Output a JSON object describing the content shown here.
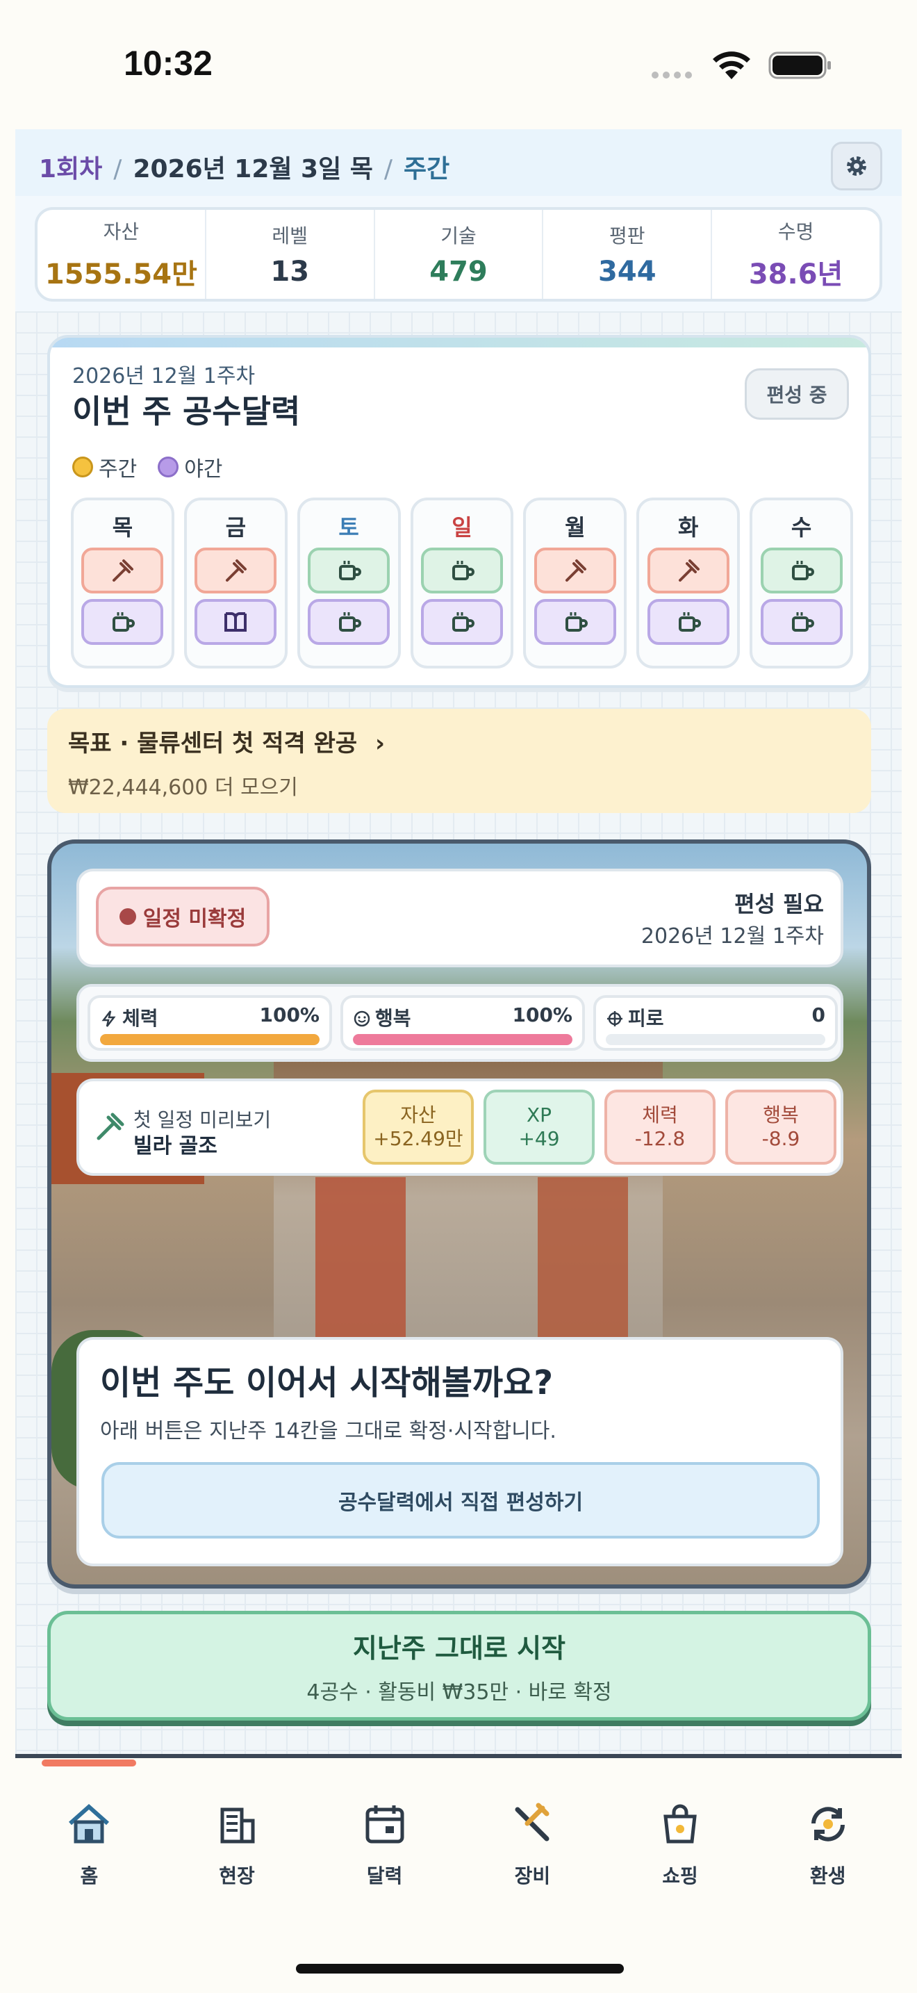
{
  "status_bar": {
    "time": "10:32"
  },
  "header": {
    "round": "1회차",
    "date": "2026년 12월 3일 목",
    "period": "주간"
  },
  "stats": [
    {
      "label": "자산",
      "value": "1555.54만",
      "color": "#a77412"
    },
    {
      "label": "레벨",
      "value": "13",
      "color": "#2c3a4a"
    },
    {
      "label": "기술",
      "value": "479",
      "color": "#2e7d5b"
    },
    {
      "label": "평판",
      "value": "344",
      "color": "#2f6aa0"
    },
    {
      "label": "수명",
      "value": "38.6년",
      "color": "#7a4cb5"
    }
  ],
  "calendar": {
    "week": "2026년 12월 1주차",
    "title": "이번 주 공수달력",
    "edit_button": "편성 중",
    "legend": {
      "day": "주간",
      "night": "야간"
    },
    "days": [
      {
        "label": "목",
        "color": "#2a3644",
        "day_slot": "work",
        "night_slot": "rest"
      },
      {
        "label": "금",
        "color": "#2a3644",
        "day_slot": "work",
        "night_slot": "study"
      },
      {
        "label": "토",
        "color": "#3b7db5",
        "day_slot": "rest",
        "night_slot": "rest"
      },
      {
        "label": "일",
        "color": "#c94343",
        "day_slot": "rest",
        "night_slot": "rest"
      },
      {
        "label": "월",
        "color": "#2a3644",
        "day_slot": "work",
        "night_slot": "rest"
      },
      {
        "label": "화",
        "color": "#2a3644",
        "day_slot": "work",
        "night_slot": "rest"
      },
      {
        "label": "수",
        "color": "#2a3644",
        "day_slot": "rest",
        "night_slot": "rest"
      }
    ]
  },
  "goal": {
    "title": "목표 · 물류센터 첫 적격 완공",
    "chevron": "›",
    "subtitle": "₩22,444,600 더 모으기"
  },
  "scene": {
    "status_pill": "일정 미확정",
    "edit_needed": "편성 필요",
    "week": "2026년 12월 1주차",
    "gauges": [
      {
        "label": "체력",
        "value": "100%",
        "fill": 1.0,
        "color": "#f2a83e",
        "icon": "bolt-icon"
      },
      {
        "label": "행복",
        "value": "100%",
        "fill": 1.0,
        "color": "#ee7a9b",
        "icon": "smile-icon"
      },
      {
        "label": "피로",
        "value": "0",
        "fill": 0.0,
        "color": "#9aa8b5",
        "icon": "fatigue-icon"
      }
    ],
    "preview": {
      "label": "첫 일정 미리보기",
      "job": "빌라 골조"
    },
    "chips": [
      {
        "label": "자산",
        "value": "+52.49만"
      },
      {
        "label": "XP",
        "value": "+49"
      },
      {
        "label": "체력",
        "value": "-12.8"
      },
      {
        "label": "행복",
        "value": "-8.9"
      }
    ],
    "prompt_title": "이번 주도 이어서 시작해볼까요?",
    "prompt_sub": "아래 버튼은 지난주 14칸을 그대로 확정·시작합니다.",
    "prompt_button": "공수달력에서 직접 편성하기"
  },
  "start_button": {
    "title": "지난주 그대로 시작",
    "subtitle": "4공수 · 활동비 ₩35만 · 바로 확정"
  },
  "tabs": [
    {
      "label": "홈",
      "icon": "home-icon"
    },
    {
      "label": "현장",
      "icon": "building-icon"
    },
    {
      "label": "달력",
      "icon": "calendar-icon"
    },
    {
      "label": "장비",
      "icon": "tools-icon"
    },
    {
      "label": "쇼핑",
      "icon": "shopping-bag-icon"
    },
    {
      "label": "환생",
      "icon": "rebirth-icon"
    }
  ]
}
